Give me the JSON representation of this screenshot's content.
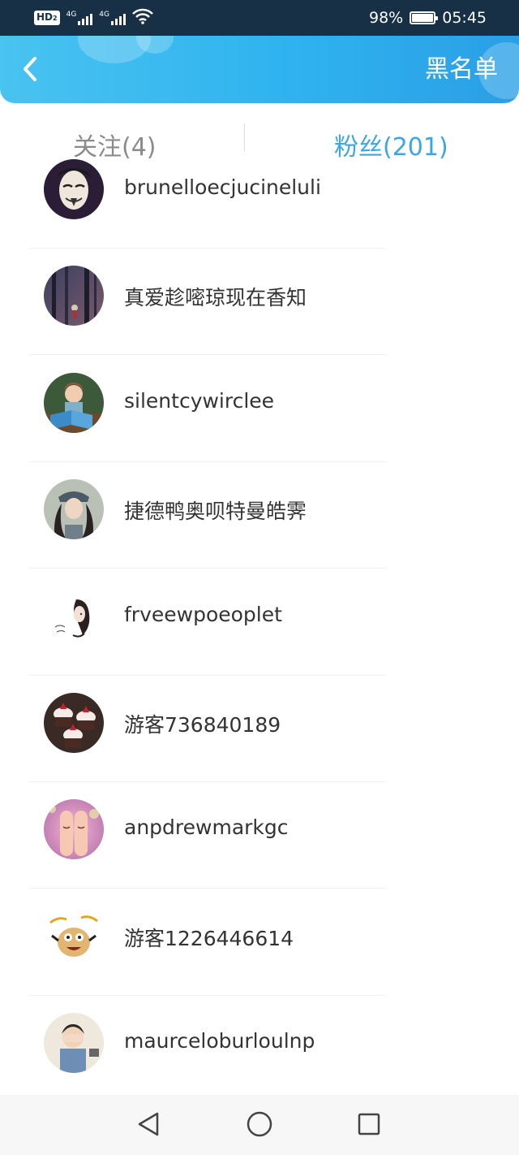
{
  "status_bar": {
    "hd_label": "HD",
    "hd_sub": "2",
    "sim1_label": "4G",
    "sim2_label": "4G",
    "battery_percent": "98%",
    "battery_level": 0.98,
    "time": "05:45",
    "icons": [
      "hd-icon",
      "signal-icon",
      "signal-icon",
      "wifi-icon",
      "battery-icon"
    ]
  },
  "header": {
    "back_icon": "chevron-left-icon",
    "right_label": "黑名单",
    "colors": {
      "gradient_start": "#49c3f0",
      "gradient_end": "#2a9fe6"
    }
  },
  "tabs": [
    {
      "label": "关注(4)",
      "active": false
    },
    {
      "label": "粉丝(201)",
      "active": true
    }
  ],
  "fans": [
    {
      "name": "brunelloecjucineluli",
      "avatar": "mask-avatar"
    },
    {
      "name": "真爱趁嘧琼现在香知",
      "avatar": "forest-avatar"
    },
    {
      "name": "silentcywirclee",
      "avatar": "child-reading-avatar"
    },
    {
      "name": "捷德鸭奥呗特曼皓霁",
      "avatar": "girl-cap-avatar"
    },
    {
      "name": "frveewpoeoplet",
      "avatar": "sketch-girl-avatar"
    },
    {
      "name": "游客736840189",
      "avatar": "cupcakes-avatar"
    },
    {
      "name": "anpdrewmarkgc",
      "avatar": "finger-faces-avatar"
    },
    {
      "name": "游客1226446614",
      "avatar": "cartoon-avatar"
    },
    {
      "name": "maurceloburloulnp",
      "avatar": "boy-covering-face-avatar"
    }
  ],
  "nav": {
    "icons": [
      "back-triangle-icon",
      "home-circle-icon",
      "recents-square-icon"
    ]
  },
  "colors": {
    "accent": "#3ba7e0",
    "inactive_tab": "#8b8b8b",
    "status_bar_bg": "#173046"
  }
}
